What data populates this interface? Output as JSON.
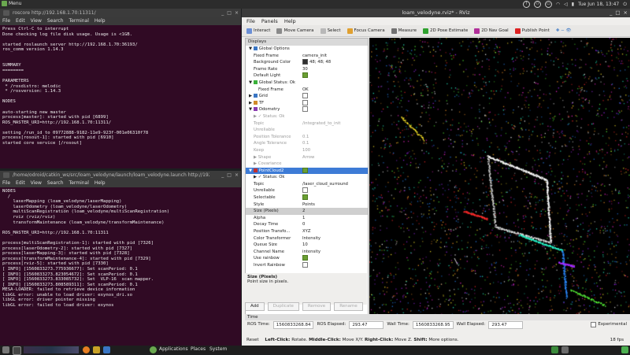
{
  "top_panel": {
    "menu_label": "Menu",
    "clock": "Tue Jun 18, 13:47",
    "tray_icons": [
      "help-icon",
      "user-icon",
      "monitor-icon",
      "network-icon",
      "volume-icon",
      "battery-icon",
      "settings-icon"
    ]
  },
  "terminal1": {
    "title": "roscore http://192.168.1.70:11311/",
    "menu": [
      "File",
      "Edit",
      "View",
      "Search",
      "Terminal",
      "Help"
    ],
    "lines": [
      "Press Ctrl-C to interrupt",
      "Done checking log file disk usage. Usage is <1GB.",
      "",
      "started roslaunch server http://192.168.1.70:36193/",
      "ros_comm version 1.14.3",
      "",
      "",
      "SUMMARY",
      "========",
      "",
      "PARAMETERS",
      " * /rosdistro: melodic",
      " * /rosversion: 1.14.3",
      "",
      "NODES",
      "",
      "auto-starting new master",
      "process[master]: started with pid [6899]",
      "ROS_MASTER_URI=http://192.168.1.70:11311/",
      "",
      "setting /run_id to 09772888-9182-11e9-923f-001e06310f78",
      "process[rosout-1]: started with pid [6910]",
      "started core service [/rosout]"
    ]
  },
  "terminal2": {
    "title": "/home/odroid/catkin_ws/src/loam_velodyne/launch/loam_velodyne.launch http://192.168...",
    "menu": [
      "File",
      "Edit",
      "View",
      "Search",
      "Terminal",
      "Help"
    ],
    "lines": [
      "NODES",
      "  /",
      "    laserMapping (loam_velodyne/laserMapping)",
      "    laserOdometry (loam_velodyne/laserOdometry)",
      "    multiScanRegistration (loam_velodyne/multiScanRegistration)",
      "    rviz (rviz/rviz)",
      "    transformMaintenance (loam_velodyne/transformMaintenance)",
      "",
      "ROS_MASTER_URI=http://192.168.1.70:11311",
      "",
      "process[multiScanRegistration-1]: started with pid [7326]",
      "process[laserOdometry-2]: started with pid [7327]",
      "process[laserMapping-3]: started with pid [7328]",
      "process[transformMaintenance-4]: started with pid [7329]",
      "process[rviz-5]: started with pid [7330]",
      "[ INFO] [1560833273.775936677]: Set scanPeriod: 0.1",
      "[ INFO] [1560833273.823054672]: Set scanPeriod: 0.1",
      "[ INFO] [1560833273.833085732]: Set  VLP-16  scan mapper.",
      "[ INFO] [1560833273.808589311]: Set scanPeriod: 0.1",
      "MESA-LOADER: failed to retrieve device information",
      "libGL error: unable to load driver: exynos_dri.so",
      "libGL error: driver pointer missing",
      "libGL error: failed to load driver: exynos"
    ]
  },
  "rviz": {
    "title": "loam_velodyne.rviz* - RViz",
    "menu": [
      "File",
      "Panels",
      "Help"
    ],
    "toolbar": [
      {
        "label": "Interact",
        "icon": "interact-icon",
        "color": "#6b8fd6"
      },
      {
        "label": "Move Camera",
        "icon": "move-camera-icon",
        "color": "#8a8a8a"
      },
      {
        "label": "Select",
        "icon": "select-icon",
        "color": "#b8b8b8"
      },
      {
        "label": "Focus Camera",
        "icon": "focus-camera-icon",
        "color": "#e0a030"
      },
      {
        "label": "Measure",
        "icon": "measure-icon",
        "color": "#707070"
      },
      {
        "label": "2D Pose Estimate",
        "icon": "pose-estimate-icon",
        "color": "#2fa12f"
      },
      {
        "label": "2D Nav Goal",
        "icon": "nav-goal-icon",
        "color": "#b12f9a"
      },
      {
        "label": "Publish Point",
        "icon": "publish-point-icon",
        "color": "#d22"
      }
    ],
    "displays": {
      "header": "Displays",
      "rows": [
        {
          "indent": 1,
          "arrow": "▼",
          "icon": "#3a76c4",
          "key": "Global Options",
          "value": ""
        },
        {
          "indent": 2,
          "key": "Fixed Frame",
          "value": "camera_init"
        },
        {
          "indent": 2,
          "key": "Background Color",
          "value": "48; 48; 48",
          "swatch": "#303030"
        },
        {
          "indent": 2,
          "key": "Frame Rate",
          "value": "30"
        },
        {
          "indent": 2,
          "key": "Default Light",
          "check": true
        },
        {
          "indent": 1,
          "arrow": "▼",
          "icon": "#3bb13b",
          "key": "Global Status: Ok",
          "value": ""
        },
        {
          "indent": 3,
          "key": "Fixed Frame",
          "value": "OK"
        },
        {
          "indent": 1,
          "arrow": "▶",
          "icon": "#3a76c4",
          "key": "Grid",
          "check": false
        },
        {
          "indent": 1,
          "arrow": "▶",
          "icon": "#d08a2a",
          "key": "TF",
          "check": false
        },
        {
          "indent": 1,
          "arrow": "▼",
          "icon": "#8a3ab0",
          "key": "Odometry",
          "check": false
        },
        {
          "indent": 2,
          "arrow": "▶",
          "dis": true,
          "key": "✓ Status: Ok",
          "value": ""
        },
        {
          "indent": 2,
          "dis": true,
          "key": "Topic",
          "value": "/integrated_to_init"
        },
        {
          "indent": 2,
          "dis": true,
          "key": "Unreliable",
          "value": ""
        },
        {
          "indent": 2,
          "dis": true,
          "key": "Position Tolerance",
          "value": "0.1"
        },
        {
          "indent": 2,
          "dis": true,
          "key": "Angle Tolerance",
          "value": "0.1"
        },
        {
          "indent": 2,
          "dis": true,
          "key": "Keep",
          "value": "100"
        },
        {
          "indent": 2,
          "arrow": "▶",
          "dis": true,
          "key": "Shape",
          "value": "Arrow"
        },
        {
          "indent": 2,
          "arrow": "▶",
          "dis": true,
          "key": "Covariance",
          "value": ""
        },
        {
          "indent": 1,
          "arrow": "▼",
          "icon": "#c03030",
          "key": "PointCloud2",
          "check": true,
          "sel": true
        },
        {
          "indent": 2,
          "arrow": "▶",
          "key": "✓ Status: Ok",
          "value": ""
        },
        {
          "indent": 2,
          "key": "Topic",
          "value": "/laser_cloud_surround"
        },
        {
          "indent": 2,
          "key": "Unreliable",
          "check": false
        },
        {
          "indent": 2,
          "key": "Selectable",
          "check": true
        },
        {
          "indent": 2,
          "key": "Style",
          "value": "Points"
        },
        {
          "indent": 2,
          "key": "Size (Pixels)",
          "value": "2",
          "hl": true
        },
        {
          "indent": 2,
          "key": "Alpha",
          "value": "1"
        },
        {
          "indent": 2,
          "key": "Decay Time",
          "value": "0"
        },
        {
          "indent": 2,
          "key": "Position Transfo...",
          "value": "XYZ"
        },
        {
          "indent": 2,
          "key": "Color Transformer",
          "value": "Intensity"
        },
        {
          "indent": 2,
          "key": "Queue Size",
          "value": "10"
        },
        {
          "indent": 2,
          "key": "Channel Name",
          "value": "intensity"
        },
        {
          "indent": 2,
          "key": "Use rainbow",
          "check": true
        },
        {
          "indent": 2,
          "key": "Invert Rainbow",
          "check": false
        }
      ],
      "desc_title": "Size (Pixels)",
      "desc_text": "Point size in pixels.",
      "buttons": [
        "Add",
        "Duplicate",
        "Remove",
        "Rename"
      ]
    },
    "time": {
      "header": "Time",
      "ros_time_label": "ROS Time:",
      "ros_time": "1560833268.84",
      "ros_elapsed_label": "ROS Elapsed:",
      "ros_elapsed": "293.47",
      "wall_time_label": "Wall Time:",
      "wall_time": "1560833268.95",
      "wall_elapsed_label": "Wall Elapsed:",
      "wall_elapsed": "293.47",
      "experimental": "Experimental"
    },
    "status": {
      "reset": "Reset",
      "hint_parts": [
        {
          "b": "Left-Click:",
          "t": " Rotate. "
        },
        {
          "b": "Middle-Click:",
          "t": " Move X/Y. "
        },
        {
          "b": "Right-Click:",
          "t": " Move Z. "
        },
        {
          "b": "Shift:",
          "t": " More options."
        }
      ],
      "fps": "18 fps"
    }
  },
  "bottom_panel": {
    "apps": "Applications",
    "places": "Places",
    "system": "System"
  }
}
